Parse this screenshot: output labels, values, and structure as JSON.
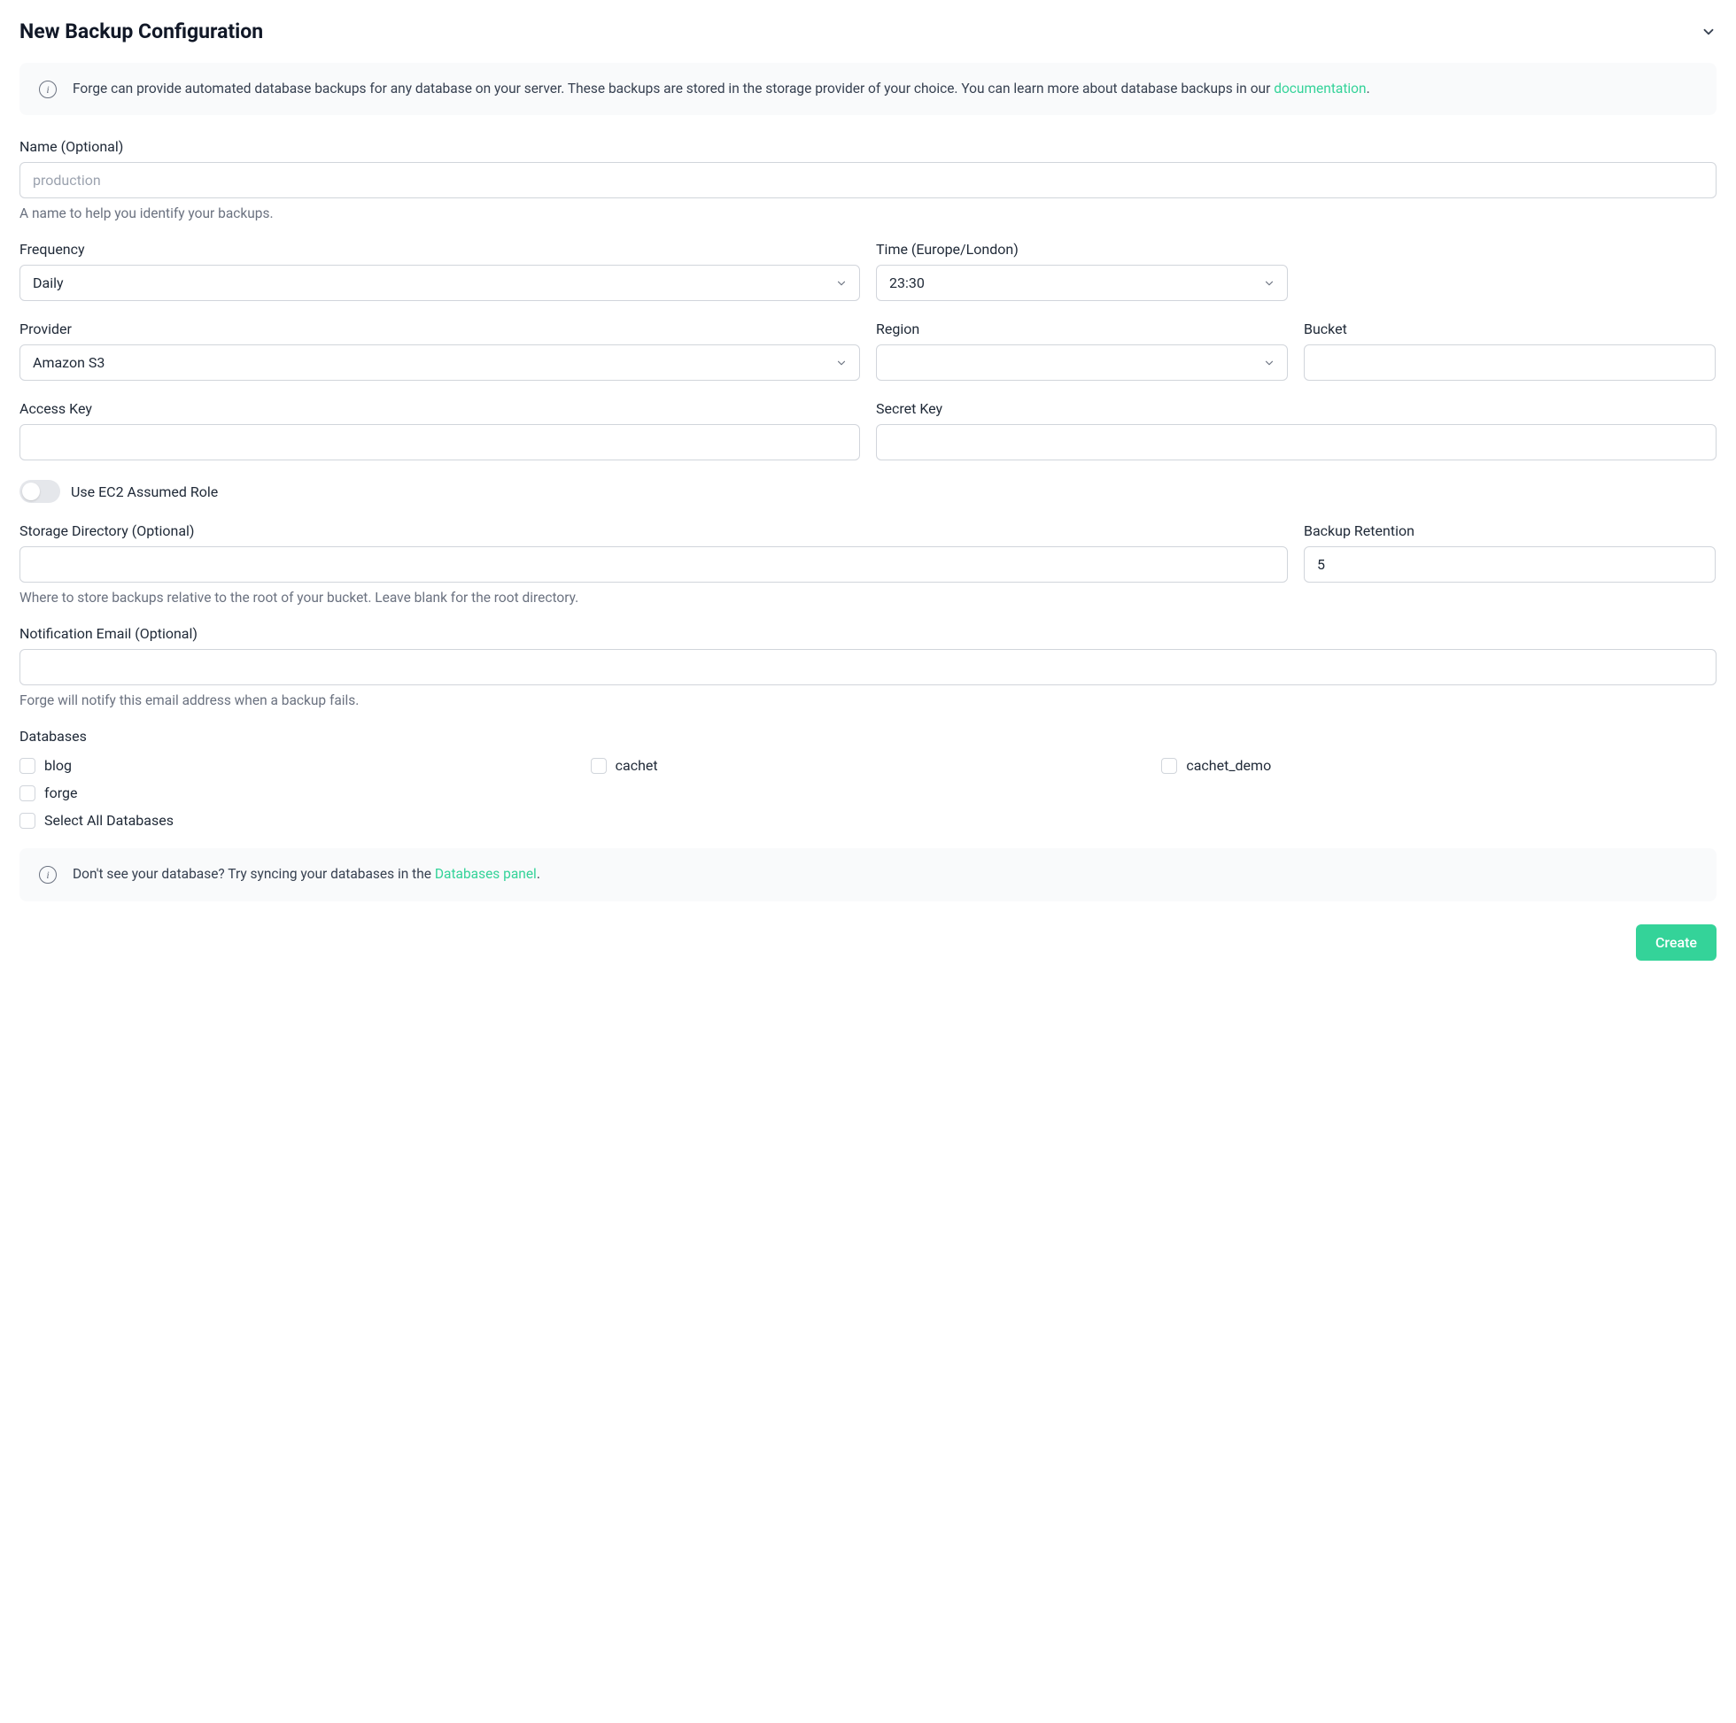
{
  "header": {
    "title": "New Backup Configuration"
  },
  "info_box_1": {
    "text_before_link": "Forge can provide automated database backups for any database on your server. These backups are stored in the storage provider of your choice. You can learn more about database backups in our ",
    "link_text": "documentation",
    "text_after_link": "."
  },
  "name": {
    "label": "Name (Optional)",
    "placeholder": "production",
    "value": "",
    "help": "A name to help you identify your backups."
  },
  "frequency": {
    "label": "Frequency",
    "value": "Daily"
  },
  "time": {
    "label": "Time (Europe/London)",
    "value": "23:30"
  },
  "provider": {
    "label": "Provider",
    "value": "Amazon S3"
  },
  "region": {
    "label": "Region",
    "value": ""
  },
  "bucket": {
    "label": "Bucket",
    "value": ""
  },
  "access_key": {
    "label": "Access Key",
    "value": ""
  },
  "secret_key": {
    "label": "Secret Key",
    "value": ""
  },
  "ec2_role": {
    "label": "Use EC2 Assumed Role"
  },
  "storage_dir": {
    "label": "Storage Directory (Optional)",
    "value": "",
    "help": "Where to store backups relative to the root of your bucket. Leave blank for the root directory."
  },
  "retention": {
    "label": "Backup Retention",
    "value": "5"
  },
  "notification_email": {
    "label": "Notification Email (Optional)",
    "value": "",
    "help": "Forge will notify this email address when a backup fails."
  },
  "databases": {
    "label": "Databases",
    "items": [
      {
        "label": "blog"
      },
      {
        "label": "cachet"
      },
      {
        "label": "cachet_demo"
      },
      {
        "label": "forge"
      }
    ],
    "select_all_label": "Select All Databases"
  },
  "info_box_2": {
    "text_before_link": "Don't see your database? Try syncing your databases in the ",
    "link_text": "Databases panel",
    "text_after_link": "."
  },
  "footer": {
    "create_label": "Create"
  }
}
